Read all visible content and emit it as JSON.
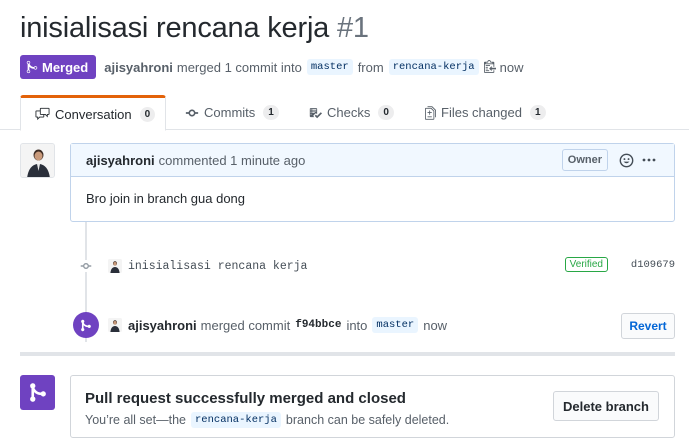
{
  "pr": {
    "title": "inisialisasi rencana kerja",
    "number": "#1",
    "state": "Merged",
    "author": "ajisyahroni",
    "merge_text": "merged 1 commit into",
    "base_branch": "master",
    "from_text": "from",
    "head_branch": "rencana-kerja",
    "time": "now"
  },
  "tabs": [
    {
      "label": "Conversation",
      "count": "0",
      "icon": "comment-discussion-icon"
    },
    {
      "label": "Commits",
      "count": "1",
      "icon": "git-commit-icon"
    },
    {
      "label": "Checks",
      "count": "0",
      "icon": "checklist-icon"
    },
    {
      "label": "Files changed",
      "count": "1",
      "icon": "file-diff-icon"
    }
  ],
  "comment": {
    "author": "ajisyahroni",
    "action": "commented 1 minute ago",
    "badge": "Owner",
    "body": "Bro join in branch gua dong"
  },
  "commit": {
    "message": "inisialisasi rencana kerja",
    "verified": "Verified",
    "sha": "d109679"
  },
  "merge_event": {
    "author": "ajisyahroni",
    "action": "merged commit",
    "sha": "f94bbce",
    "into_text": "into",
    "branch": "master",
    "time": "now",
    "revert_label": "Revert"
  },
  "merge_box": {
    "title": "Pull request successfully merged and closed",
    "desc_prefix": "You’re all set—the",
    "branch": "rencana-kerja",
    "desc_suffix": "branch can be safely deleted.",
    "delete_label": "Delete branch"
  },
  "colors": {
    "merged_purple": "#6f42c1",
    "tab_accent": "#e36209",
    "link_blue": "#0366d6",
    "verified_green": "#28a745"
  }
}
